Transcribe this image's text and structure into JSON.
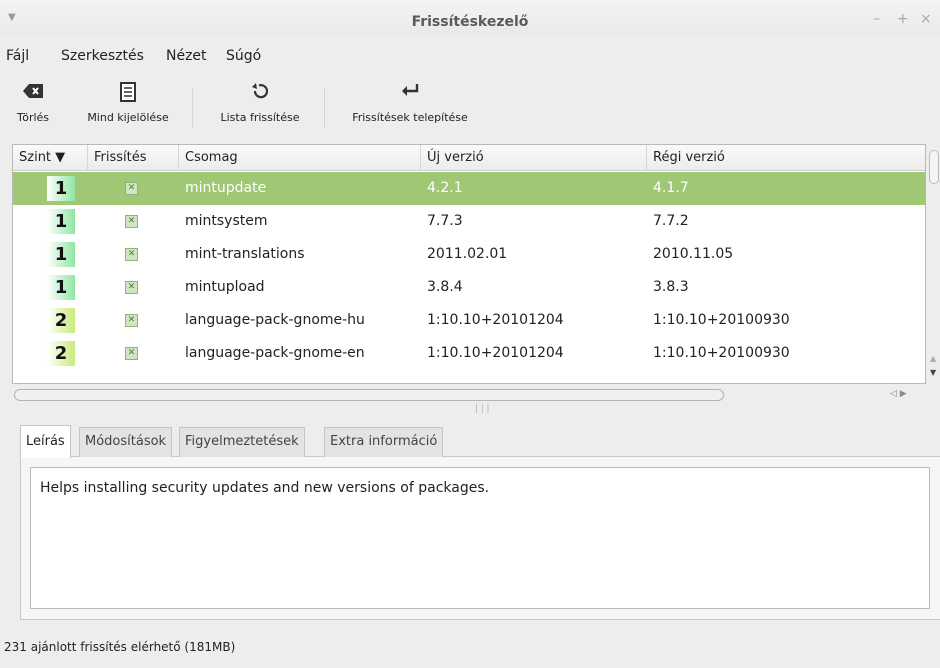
{
  "window": {
    "title": "Frissítéskezelő"
  },
  "menu": [
    {
      "label": "Fájl",
      "name": "menu-file"
    },
    {
      "label": "Szerkesztés",
      "name": "menu-edit"
    },
    {
      "label": "Nézet",
      "name": "menu-view"
    },
    {
      "label": "Súgó",
      "name": "menu-help"
    }
  ],
  "toolbar": {
    "clear_label": "Törlés",
    "select_all_label": "Mind kijelölése",
    "refresh_label": "Lista frissítése",
    "install_label": "Frissítések telepítése"
  },
  "table": {
    "columns": [
      "Szint ▼",
      "Frissítés",
      "Csomag",
      "Új verzió",
      "Régi verzió"
    ],
    "rows": [
      {
        "level": "1",
        "package": "mintupdate",
        "new_version": "4.2.1",
        "old_version": "4.1.7",
        "selected": true
      },
      {
        "level": "1",
        "package": "mintsystem",
        "new_version": "7.7.3",
        "old_version": "7.7.2",
        "selected": false
      },
      {
        "level": "1",
        "package": "mint-translations",
        "new_version": "2011.02.01",
        "old_version": "2010.11.05",
        "selected": false
      },
      {
        "level": "1",
        "package": "mintupload",
        "new_version": "3.8.4",
        "old_version": "3.8.3",
        "selected": false
      },
      {
        "level": "2",
        "package": "language-pack-gnome-hu",
        "new_version": "1:10.10+20101204",
        "old_version": "1:10.10+20100930",
        "selected": false
      },
      {
        "level": "2",
        "package": "language-pack-gnome-en",
        "new_version": "1:10.10+20101204",
        "old_version": "1:10.10+20100930",
        "selected": false
      }
    ]
  },
  "tabs": [
    "Leírás",
    "Módosítások",
    "Figyelmeztetések",
    "Extra információ"
  ],
  "description": "Helps installing security updates and new versions of packages.",
  "status": "231 ajánlott frissítés elérhető (181MB)",
  "colors": {
    "selection": "#9fc774",
    "level1": "#8fe6a4",
    "level2": "#c9ea7a"
  }
}
